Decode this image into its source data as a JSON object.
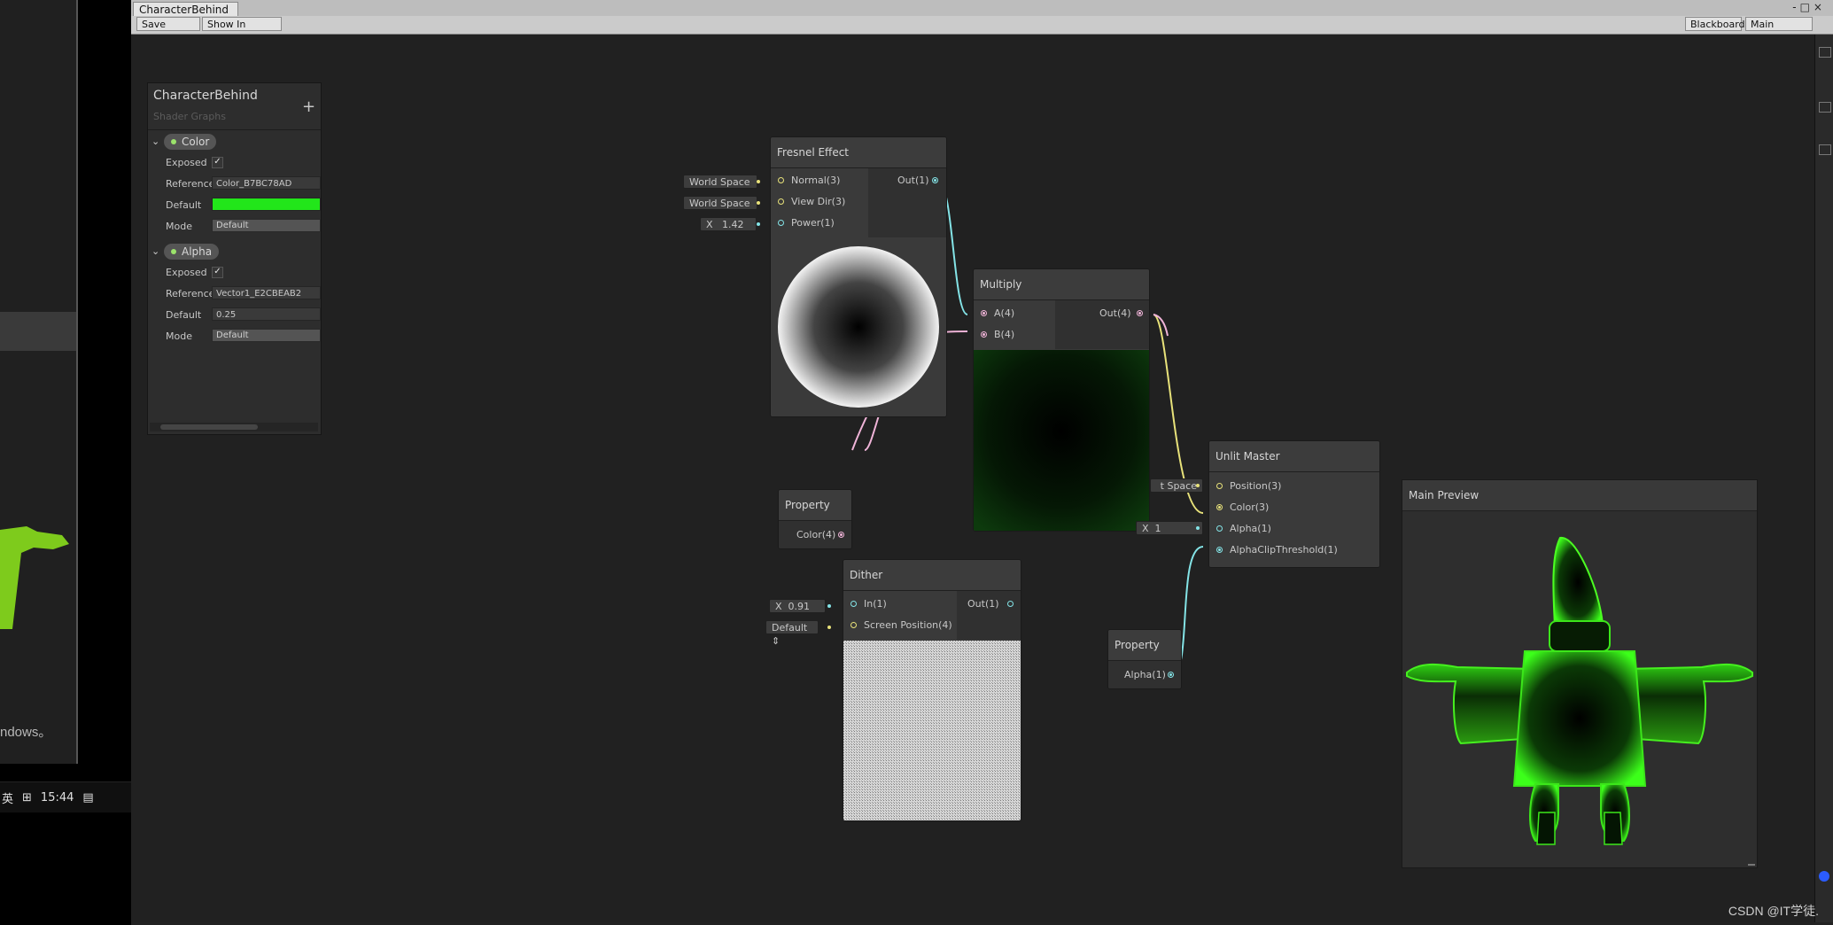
{
  "window": {
    "tab_title": "CharacterBehind",
    "controls": "-□×"
  },
  "toolbar": {
    "save_asset": "Save Asset",
    "show_in_project": "Show In Project",
    "blackboard": "Blackboard",
    "main_preview": "Main Preview"
  },
  "background": {
    "left_text": "ndows。",
    "taskbar_lang": "英",
    "taskbar_grid": "⊞",
    "taskbar_time": "15:44",
    "taskbar_msg": "▤"
  },
  "blackboard": {
    "title": "CharacterBehind",
    "subtitle": "Shader Graphs",
    "add": "+",
    "properties": [
      {
        "name": "Color",
        "exposed_label": "Exposed",
        "exposed": "✓",
        "reference_label": "Reference",
        "reference": "Color_B7BC78AD",
        "default_label": "Default",
        "default_color": "#22e61a",
        "mode_label": "Mode",
        "mode": "Default"
      },
      {
        "name": "Alpha",
        "exposed_label": "Exposed",
        "exposed": "✓",
        "reference_label": "Reference",
        "reference": "Vector1_E2CBEAB2",
        "default_label": "Default",
        "default": "0.25",
        "mode_label": "Mode",
        "mode": "Default"
      }
    ]
  },
  "nodes": {
    "fresnel": {
      "title": "Fresnel Effect",
      "in_normal": "Normal(3)",
      "in_viewdir": "View Dir(3)",
      "in_power": "Power(1)",
      "out": "Out(1)",
      "chip_normal": "World Space",
      "chip_viewdir": "World Space",
      "chip_power_x": "X",
      "chip_power_val": "1.42"
    },
    "multiply": {
      "title": "Multiply",
      "in_a": "A(4)",
      "in_b": "B(4)",
      "out": "Out(4)"
    },
    "unlit": {
      "title": "Unlit Master",
      "in_position": "Position(3)",
      "in_color": "Color(3)",
      "in_alpha": "Alpha(1)",
      "in_clip": "AlphaClipThreshold(1)",
      "chip_position": "t Space",
      "chip_alpha_x": "X",
      "chip_alpha_val": "1"
    },
    "property_color": {
      "title": "Property",
      "out": "Color(4)"
    },
    "dither": {
      "title": "Dither",
      "in_in": "In(1)",
      "in_screen": "Screen Position(4)",
      "out": "Out(1)",
      "chip_in_x": "X",
      "chip_in_val": "0.91",
      "chip_screen": "Default ⇕"
    },
    "property_alpha": {
      "title": "Property",
      "out": "Alpha(1)"
    }
  },
  "main_preview": {
    "title": "Main Preview"
  },
  "watermark": "CSDN @IT学徒."
}
